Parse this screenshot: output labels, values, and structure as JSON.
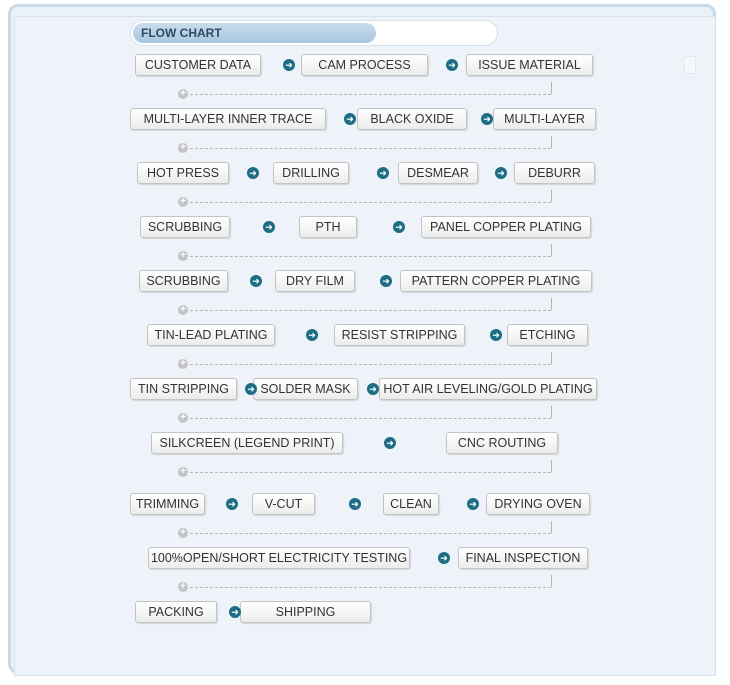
{
  "title": "FLOW CHART",
  "steps": [
    "CUSTOMER DATA",
    "CAM PROCESS",
    "ISSUE MATERIAL",
    "MULTI-LAYER INNER TRACE",
    "BLACK OXIDE",
    "MULTI-LAYER",
    "HOT PRESS",
    "DRILLING",
    "DESMEAR",
    "DEBURR",
    "SCRUBBING",
    "PTH",
    "PANEL COPPER PLATING",
    "SCRUBBING",
    "DRY FILM",
    "PATTERN COPPER PLATING",
    "TIN-LEAD PLATING",
    "RESIST STRIPPING",
    "ETCHING",
    "TIN STRIPPING",
    "SOLDER MASK",
    "HOT AIR LEVELING/GOLD PLATING",
    "SILKCREEN (LEGEND PRINT)",
    "CNC ROUTING",
    "TRIMMING",
    "V-CUT",
    "CLEAN",
    "DRYING OVEN",
    "100%OPEN/SHORT ELECTRICITY TESTING",
    "FINAL INSPECTION",
    "PACKING",
    "SHIPPING"
  ],
  "icons": {
    "arrow": "arrow-right-icon",
    "connector": "plus-icon"
  },
  "colors": {
    "arrow": "#1f6d84",
    "title_bar": "#a9c6e0"
  }
}
